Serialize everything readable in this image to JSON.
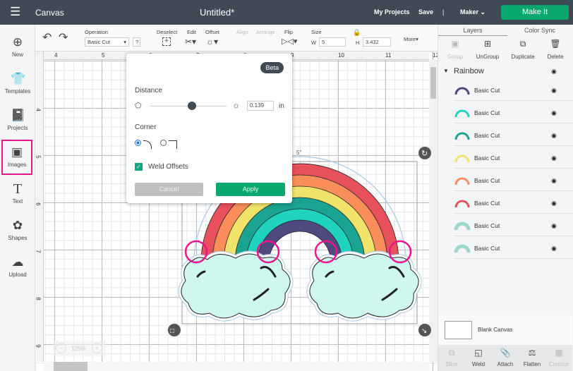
{
  "topbar": {
    "title": "Canvas",
    "doc_title": "Untitled*",
    "my_projects": "My Projects",
    "save": "Save",
    "separator": "|",
    "machine": "Maker",
    "make_it": "Make It"
  },
  "sidebar": {
    "items": [
      {
        "label": "New",
        "icon": "plus-circle"
      },
      {
        "label": "Templates",
        "icon": "shirt"
      },
      {
        "label": "Projects",
        "icon": "notebook"
      },
      {
        "label": "Images",
        "icon": "image",
        "active": true
      },
      {
        "label": "Text",
        "icon": "text-t"
      },
      {
        "label": "Shapes",
        "icon": "shapes"
      },
      {
        "label": "Upload",
        "icon": "cloud-upload"
      }
    ]
  },
  "toolbar": {
    "operation_label": "Operation",
    "operation_value": "Basic Cut",
    "help": "?",
    "deselect": "Deselect",
    "edit": "Edit",
    "offset": "Offset",
    "align": "Align",
    "arrange": "Arrange",
    "flip": "Flip",
    "size": "Size",
    "w_label": "W",
    "w_value": "5",
    "h_label": "H",
    "h_value": "3.432",
    "more": "More"
  },
  "rulers": {
    "top": [
      "4",
      "5",
      "6",
      "7",
      "8",
      "9",
      "10",
      "11",
      "12"
    ],
    "left": [
      "4",
      "5",
      "6",
      "7",
      "8",
      "9"
    ]
  },
  "canvas": {
    "width_label": "5\"",
    "zoom": "125%",
    "highlight_color": "#e8158c"
  },
  "offset_popup": {
    "badge": "Beta",
    "distance_label": "Distance",
    "distance_value": "0.139",
    "unit": "in",
    "slider_fraction": 0.5,
    "corner_label": "Corner",
    "corner_selected": "rounded",
    "weld_label": "Weld Offsets",
    "weld_checked": true,
    "cancel": "Cancel",
    "apply": "Apply"
  },
  "right_panel": {
    "tabs": [
      "Layers",
      "Color Sync"
    ],
    "actions": [
      "Group",
      "UnGroup",
      "Duplicate",
      "Delete"
    ],
    "group_name": "Rainbow",
    "layers": [
      {
        "name": "Basic Cut",
        "color": "#4e4a7f"
      },
      {
        "name": "Basic Cut",
        "color": "#1fd3be"
      },
      {
        "name": "Basic Cut",
        "color": "#1aa38f"
      },
      {
        "name": "Basic Cut",
        "color": "#f0e36a"
      },
      {
        "name": "Basic Cut",
        "color": "#f98e5b"
      },
      {
        "name": "Basic Cut",
        "color": "#e8505b"
      },
      {
        "name": "Basic Cut",
        "color": "#cdf5ee"
      },
      {
        "name": "Basic Cut",
        "color": "#cdf5ee"
      }
    ],
    "blank_canvas": "Blank Canvas",
    "bottom_actions": [
      "Slice",
      "Weld",
      "Attach",
      "Flatten",
      "Contour"
    ]
  }
}
